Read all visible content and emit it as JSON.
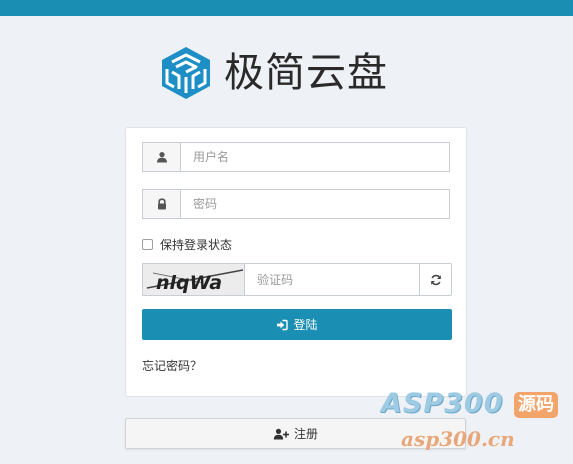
{
  "brand": {
    "title": "极简云盘",
    "logo_icon": "cube-logo-icon",
    "logo_color": "#1e8fc6"
  },
  "login": {
    "username_placeholder": "用户名",
    "username_icon": "user-icon",
    "password_placeholder": "密码",
    "password_icon": "lock-icon",
    "remember_label": "保持登录状态",
    "remember_checked": false,
    "captcha_text": "nlqWa",
    "captcha_placeholder": "验证码",
    "refresh_icon": "refresh-icon",
    "submit_label": "登陆",
    "submit_icon": "sign-in-icon",
    "forgot_label": "忘记密码？"
  },
  "register": {
    "label": "注册",
    "icon": "user-plus-icon"
  },
  "watermark": {
    "brand": "ASP300",
    "badge": "源码",
    "url": "asp300.cn"
  },
  "theme": {
    "accent": "#1a8fb3",
    "background": "#eef1f5"
  }
}
